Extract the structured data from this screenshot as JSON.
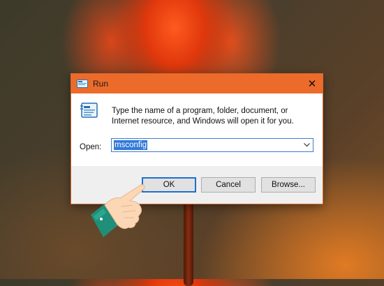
{
  "window": {
    "title": "Run",
    "close_glyph": "✕"
  },
  "body": {
    "description": "Type the name of a program, folder, document, or Internet resource, and Windows will open it for you.",
    "open_label": "Open:",
    "open_value": "msconfig"
  },
  "buttons": {
    "ok": "OK",
    "cancel": "Cancel",
    "browse": "Browse..."
  },
  "colors": {
    "titlebar": "#ec6b2a",
    "selection": "#3179d8",
    "focus_border": "#1e6fd0"
  },
  "icons": [
    "run-title-icon",
    "run-app-icon",
    "close-icon",
    "dropdown-arrow-icon",
    "pointing-hand-icon"
  ]
}
